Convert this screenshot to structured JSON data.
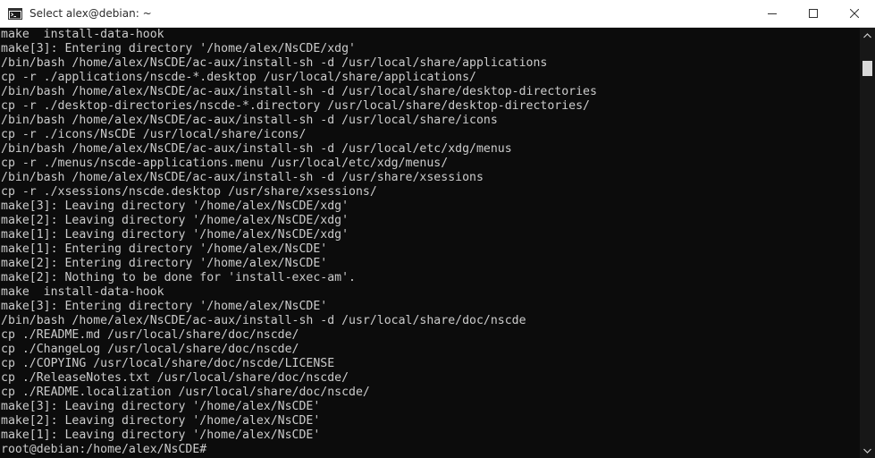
{
  "window": {
    "title": "Select alex@debian: ~",
    "icon": "console-icon",
    "controls": [
      "minimize-icon",
      "maximize-icon",
      "close-icon"
    ]
  },
  "colors": {
    "terminal_bg": "#0c0c0c",
    "terminal_fg": "#cccccc",
    "titlebar_bg": "#ffffff",
    "scrollbar_bg": "#171717",
    "scrollbar_thumb": "#d9d9d9"
  },
  "terminal": {
    "lines": [
      "make  install-data-hook",
      "make[3]: Entering directory '/home/alex/NsCDE/xdg'",
      "/bin/bash /home/alex/NsCDE/ac-aux/install-sh -d /usr/local/share/applications",
      "cp -r ./applications/nscde-*.desktop /usr/local/share/applications/",
      "/bin/bash /home/alex/NsCDE/ac-aux/install-sh -d /usr/local/share/desktop-directories",
      "cp -r ./desktop-directories/nscde-*.directory /usr/local/share/desktop-directories/",
      "/bin/bash /home/alex/NsCDE/ac-aux/install-sh -d /usr/local/share/icons",
      "cp -r ./icons/NsCDE /usr/local/share/icons/",
      "/bin/bash /home/alex/NsCDE/ac-aux/install-sh -d /usr/local/etc/xdg/menus",
      "cp -r ./menus/nscde-applications.menu /usr/local/etc/xdg/menus/",
      "/bin/bash /home/alex/NsCDE/ac-aux/install-sh -d /usr/share/xsessions",
      "cp -r ./xsessions/nscde.desktop /usr/share/xsessions/",
      "make[3]: Leaving directory '/home/alex/NsCDE/xdg'",
      "make[2]: Leaving directory '/home/alex/NsCDE/xdg'",
      "make[1]: Leaving directory '/home/alex/NsCDE/xdg'",
      "make[1]: Entering directory '/home/alex/NsCDE'",
      "make[2]: Entering directory '/home/alex/NsCDE'",
      "make[2]: Nothing to be done for 'install-exec-am'.",
      "make  install-data-hook",
      "make[3]: Entering directory '/home/alex/NsCDE'",
      "/bin/bash /home/alex/NsCDE/ac-aux/install-sh -d /usr/local/share/doc/nscde",
      "cp ./README.md /usr/local/share/doc/nscde/",
      "cp ./ChangeLog /usr/local/share/doc/nscde/",
      "cp ./COPYING /usr/local/share/doc/nscde/LICENSE",
      "cp ./ReleaseNotes.txt /usr/local/share/doc/nscde/",
      "cp ./README.localization /usr/local/share/doc/nscde/",
      "make[3]: Leaving directory '/home/alex/NsCDE'",
      "make[2]: Leaving directory '/home/alex/NsCDE'",
      "make[1]: Leaving directory '/home/alex/NsCDE'"
    ],
    "prompt": "root@debian:/home/alex/NsCDE#"
  },
  "scrollbar": {
    "up_icon": "scroll-up-arrow-icon",
    "down_icon": "scroll-down-arrow-icon"
  }
}
